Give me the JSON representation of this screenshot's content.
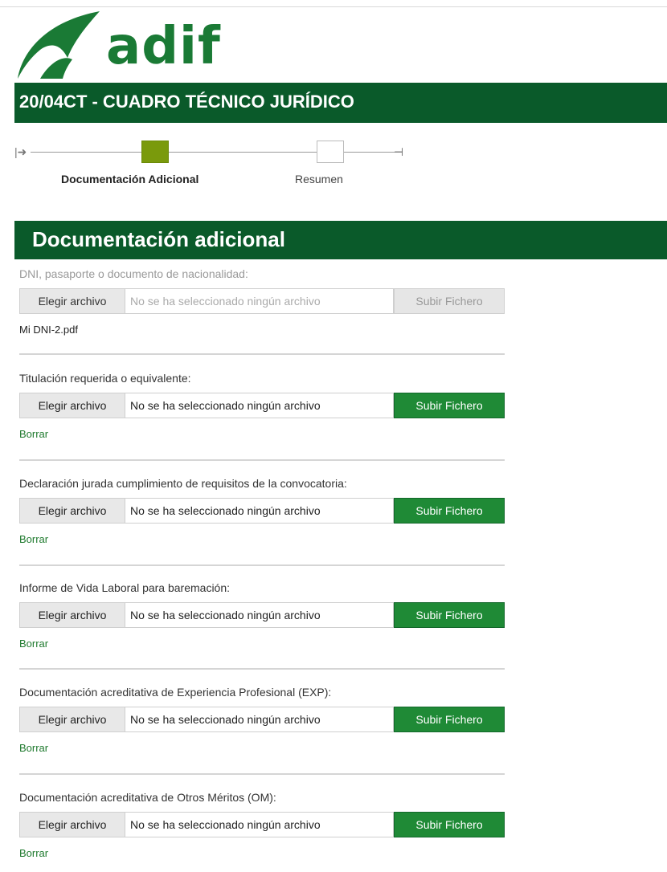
{
  "brand": {
    "name": "adif",
    "primary_color": "#0a5a2a",
    "accent_color": "#1f8a36"
  },
  "header": {
    "title": "20/04CT - CUADRO TÉCNICO JURÍDICO"
  },
  "stepper": {
    "start_glyph": "|➜",
    "end_glyph": "⊣",
    "steps": [
      {
        "label": "Documentación Adicional",
        "active": true
      },
      {
        "label": "Resumen",
        "active": false
      }
    ]
  },
  "section": {
    "title": "Documentación adicional"
  },
  "documents": [
    {
      "label": "DNI, pasaporte o documento de nacionalidad:",
      "choose_label": "Elegir archivo",
      "file_status": "No se ha seleccionado ningún archivo",
      "upload_label": "Subir Fichero",
      "extra": "Mi DNI-2.pdf",
      "disabled": true
    },
    {
      "label": "Titulación requerida o equivalente:",
      "choose_label": "Elegir archivo",
      "file_status": "No se ha seleccionado ningún archivo",
      "upload_label": "Subir Fichero",
      "extra": "Borrar",
      "disabled": false
    },
    {
      "label": "Declaración jurada cumplimiento de requisitos de la convocatoria:",
      "choose_label": "Elegir archivo",
      "file_status": "No se ha seleccionado ningún archivo",
      "upload_label": "Subir Fichero",
      "extra": "Borrar",
      "disabled": false
    },
    {
      "label": "Informe de Vida Laboral para baremación:",
      "choose_label": "Elegir archivo",
      "file_status": "No se ha seleccionado ningún archivo",
      "upload_label": "Subir Fichero",
      "extra": "Borrar",
      "disabled": false
    },
    {
      "label": "Documentación acreditativa de Experiencia Profesional (EXP):",
      "choose_label": "Elegir archivo",
      "file_status": "No se ha seleccionado ningún archivo",
      "upload_label": "Subir Fichero",
      "extra": "Borrar",
      "disabled": false
    },
    {
      "label": "Documentación acreditativa de Otros Méritos (OM):",
      "choose_label": "Elegir archivo",
      "file_status": "No se ha seleccionado ningún archivo",
      "upload_label": "Subir Fichero",
      "extra": "Borrar",
      "disabled": false
    }
  ]
}
